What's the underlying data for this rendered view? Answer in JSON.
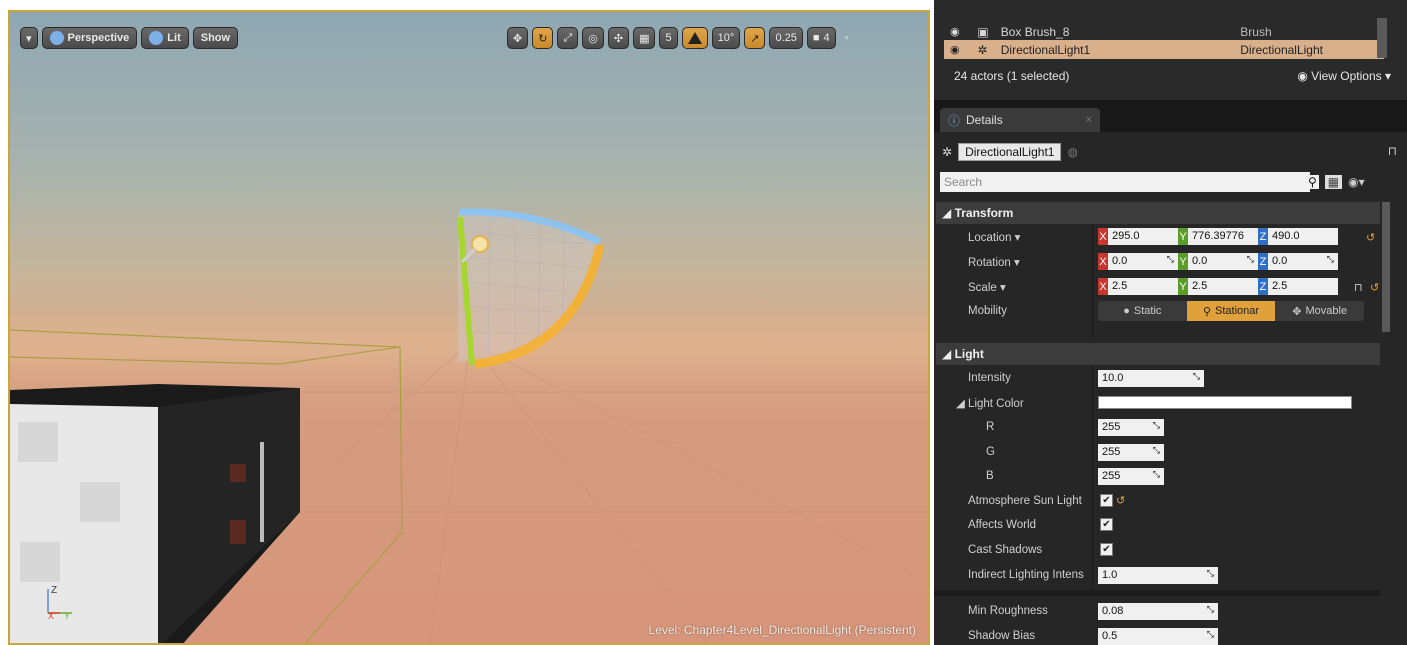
{
  "viewport": {
    "menu_label": "▾",
    "perspective_label": "Perspective",
    "lit_label": "Lit",
    "show_label": "Show",
    "grid_snap_value": "5",
    "rotation_snap_value": "10°",
    "scale_snap_value": "0.25",
    "camera_speed_value": "4",
    "level_label": "Level:  Chapter4Level_DirectionalLight (Persistent)",
    "axis_labels": {
      "z": "Z",
      "x": "X",
      "y": "Y"
    }
  },
  "outliner": {
    "rows": [
      {
        "name": "Box Brush_8",
        "type": "Brush",
        "selected": false
      },
      {
        "name": "DirectionalLight1",
        "type": "DirectionalLight",
        "selected": true
      }
    ],
    "count_text": "24 actors (1 selected)",
    "view_options_label": "View Options"
  },
  "details": {
    "tab_label": "Details",
    "tab_close": "×",
    "actor_name": "DirectionalLight1",
    "search_placeholder": "Search",
    "transform": {
      "header": "Transform",
      "location_label": "Location ▾",
      "rotation_label": "Rotation ▾",
      "scale_label": "Scale ▾",
      "mobility_label": "Mobility",
      "location": {
        "x": "295.0",
        "y": "776.39776",
        "z": "490.0"
      },
      "rotation": {
        "x": "0.0",
        "y": "0.0",
        "z": "0.0"
      },
      "scale": {
        "x": "2.5",
        "y": "2.5",
        "z": "2.5"
      },
      "mobility_options": [
        "Static",
        "Stationar",
        "Movable"
      ],
      "mobility_selected": "Stationar"
    },
    "light": {
      "header": "Light",
      "intensity_label": "Intensity",
      "intensity_value": "10.0",
      "light_color_label": "Light Color",
      "r_label": "R",
      "r_value": "255",
      "g_label": "G",
      "g_value": "255",
      "b_label": "B",
      "b_value": "255",
      "atmosphere_label": "Atmosphere Sun Light",
      "affects_world_label": "Affects World",
      "cast_shadows_label": "Cast Shadows",
      "indirect_label": "Indirect Lighting Intens",
      "indirect_value": "1.0",
      "min_roughness_label": "Min Roughness",
      "min_roughness_value": "0.08",
      "shadow_bias_label": "Shadow Bias",
      "shadow_bias_value": "0.5",
      "atmosphere_checked": true,
      "affects_world_checked": true,
      "cast_shadows_checked": true
    }
  },
  "colors": {
    "selection": "#d9b08c",
    "accent": "#e0a03a",
    "x_axis": "#c8372d",
    "y_axis": "#5a9e2a",
    "z_axis": "#2f6fc8"
  }
}
